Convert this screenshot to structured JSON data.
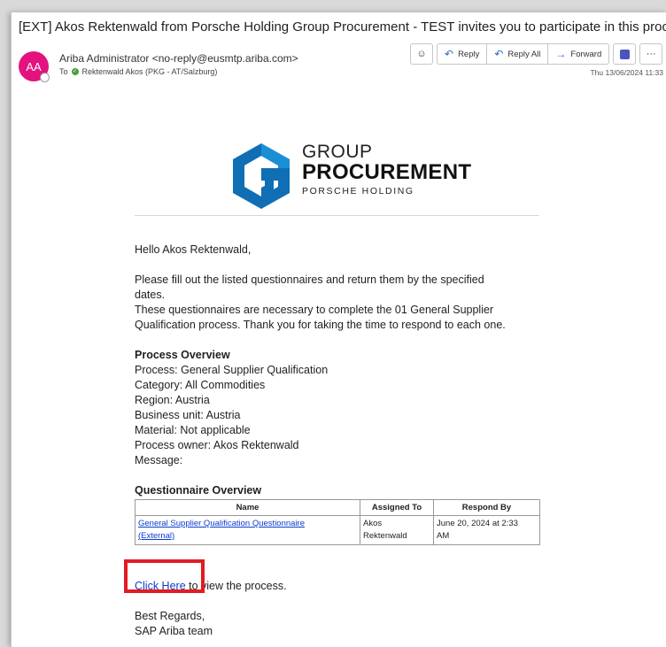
{
  "email": {
    "subject": "[EXT] Akos Rektenwald from Porsche Holding Group Procurement - TEST invites you to participate in this proces...",
    "avatar_initials": "AA",
    "sender": "Ariba Administrator <no-reply@eusmtp.ariba.com>",
    "to_label": "To",
    "recipient": "Rektenwald Akos (PKG - AT/Salzburg)",
    "date": "Thu 13/06/2024 11:33"
  },
  "toolbar": {
    "emoji_icon": "smiley-icon",
    "reply_label": "Reply",
    "reply_all_label": "Reply All",
    "forward_label": "Forward",
    "more_label": "···"
  },
  "logo": {
    "line1": "GROUP",
    "line2": "PROCUREMENT",
    "line3": "PORSCHE HOLDING"
  },
  "body": {
    "greeting": "Hello Akos Rektenwald,",
    "para1_line1": "Please fill out the listed questionnaires and return them by the specified",
    "para1_line2": "dates.",
    "para2_line1": "These questionnaires are necessary to complete the 01 General Supplier",
    "para2_line2": "Qualification process. Thank you for taking the time to respond to each one.",
    "overview_title": "Process Overview",
    "process": "Process: General Supplier Qualification",
    "category": "Category: All Commodities",
    "region": "Region: Austria",
    "business_unit": "Business unit: Austria",
    "material": "Material: Not applicable",
    "owner": "Process owner: Akos Rektenwald",
    "message": "Message:",
    "questionnaire_title": "Questionnaire Overview",
    "click_here": "Click Here",
    "click_rest": " to view the process.",
    "regards1": "Best Regards,",
    "regards2": "SAP Ariba team"
  },
  "table": {
    "headers": [
      "Name",
      "Assigned To",
      "Respond By"
    ],
    "rows": [
      {
        "name_line1": "General Supplier Qualification Questionnaire",
        "name_line2": "(External)",
        "assigned_line1": "Akos",
        "assigned_line2": "Rektenwald",
        "respond_line1": "June 20, 2024 at 2:33",
        "respond_line2": "AM"
      }
    ]
  },
  "colors": {
    "avatar": "#e3127e",
    "highlight_box": "#e31b23",
    "logo_blue": "#0f6eb4",
    "link": "#0b3ccf"
  }
}
